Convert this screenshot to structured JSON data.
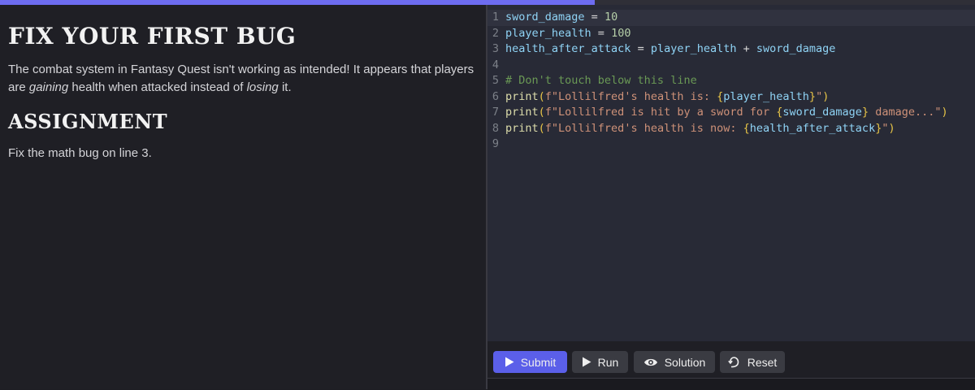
{
  "progress": {
    "fraction": 0.61
  },
  "lesson": {
    "title": "FIX YOUR FIRST BUG",
    "intro_part1": "The combat system in Fantasy Quest isn't working as intended! It appears that players are ",
    "intro_em1": "gaining",
    "intro_part2": " health when attacked instead of ",
    "intro_em2": "losing",
    "intro_part3": " it.",
    "assignment_heading": "ASSIGNMENT",
    "assignment_text": "Fix the math bug on line 3."
  },
  "editor": {
    "lines": [
      {
        "n": "1",
        "var1": "sword_damage",
        "op": " = ",
        "num": "10"
      },
      {
        "n": "2",
        "var1": "player_health",
        "op": " = ",
        "num": "100"
      },
      {
        "n": "3",
        "var1": "health_after_attack",
        "op": " = ",
        "var2": "player_health",
        "op2": " + ",
        "var3": "sword_damage"
      },
      {
        "n": "4"
      },
      {
        "n": "5",
        "comment": "# Don't touch below this line"
      },
      {
        "n": "6",
        "fn": "print",
        "open": "(",
        "str": "f\"Lollilfred's health is: ",
        "brace_o": "{",
        "ivar": "player_health",
        "brace_c": "}",
        "str_end": "\"",
        "close": ")"
      },
      {
        "n": "7",
        "fn": "print",
        "open": "(",
        "str": "f\"Lollilfred is hit by a sword for ",
        "brace_o": "{",
        "ivar": "sword_damage",
        "brace_c": "}",
        "str_end": " damage...\"",
        "close": ")"
      },
      {
        "n": "8",
        "fn": "print",
        "open": "(",
        "str": "f\"Lollilfred's health is now: ",
        "brace_o": "{",
        "ivar": "health_after_attack",
        "brace_c": "}",
        "str_end": "\"",
        "close": ")"
      },
      {
        "n": "9"
      }
    ]
  },
  "toolbar": {
    "submit_label": "Submit",
    "run_label": "Run",
    "solution_label": "Solution",
    "reset_label": "Reset"
  },
  "icons": {
    "submit": "play-icon",
    "run": "play-icon",
    "solution": "eye-icon",
    "reset": "undo-icon"
  },
  "colors": {
    "accent": "#5b5fe9",
    "editor_bg": "#282a36",
    "panel_bg": "#1f1f25"
  }
}
